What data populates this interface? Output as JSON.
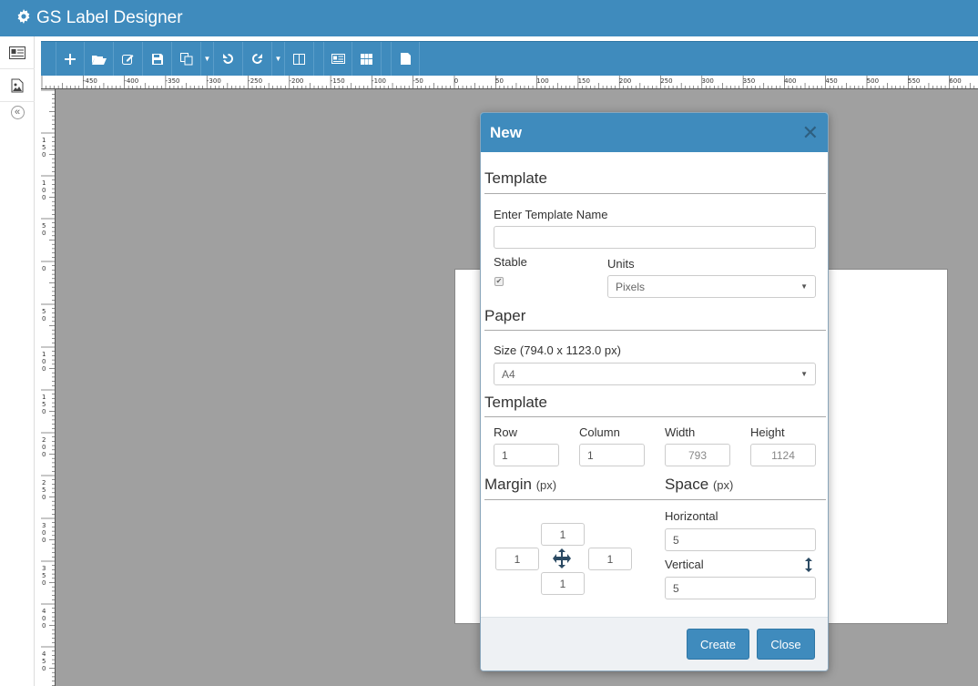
{
  "app": {
    "title": "GS Label Designer"
  },
  "sidebar": {
    "items": [
      {
        "name": "id-card-icon"
      },
      {
        "name": "image-icon"
      }
    ],
    "collapse_glyph": "«"
  },
  "toolbar": {
    "buttons": [
      "new",
      "open",
      "edit",
      "save",
      "copy",
      "undo",
      "redo",
      "columns",
      "id-card",
      "grid",
      "page"
    ]
  },
  "ruler": {
    "top_ticks": [
      "-450",
      "-400",
      "-350",
      "-300",
      "-250",
      "-200",
      "-150",
      "-100",
      "-50",
      "0",
      "50",
      "100",
      "150",
      "200",
      "250",
      "300",
      "350",
      "400",
      "450",
      "500",
      "550",
      "600"
    ],
    "left_ticks": [
      "150",
      "100",
      "50",
      "0",
      "50",
      "100",
      "150",
      "200",
      "250",
      "300",
      "350",
      "400",
      "450"
    ]
  },
  "modal": {
    "title": "New",
    "close_glyph": "✕",
    "template_section": "Template",
    "template_name_label": "Enter Template Name",
    "template_name_value": "",
    "stable_label": "Stable",
    "stable_checked": true,
    "units_label": "Units",
    "units_value": "Pixels",
    "paper_section": "Paper",
    "size_label": "Size (794.0 x 1123.0 px)",
    "size_value": "A4",
    "template_section2": "Template",
    "row_label": "Row",
    "row_value": "1",
    "column_label": "Column",
    "column_value": "1",
    "width_label": "Width",
    "width_value": "793",
    "height_label": "Height",
    "height_value": "1124",
    "margin_label": "Margin",
    "margin_unit": "(px)",
    "space_label": "Space",
    "space_unit": "(px)",
    "margin_top": "1",
    "margin_left": "1",
    "margin_right": "1",
    "margin_bottom": "1",
    "horizontal_label": "Horizontal",
    "horizontal_value": "5",
    "vertical_label": "Vertical",
    "vertical_value": "5",
    "create_label": "Create",
    "close_label": "Close"
  }
}
